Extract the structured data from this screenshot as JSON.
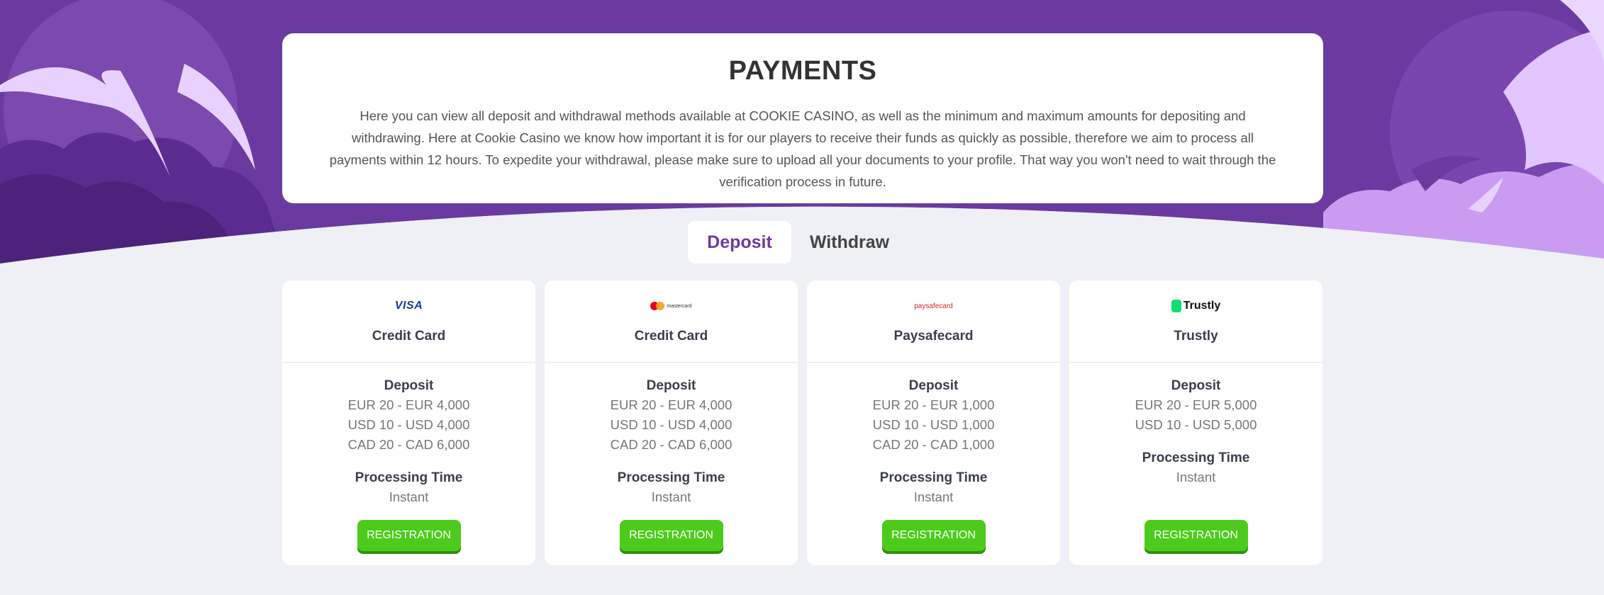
{
  "header": {
    "title": "PAYMENTS",
    "description": "Here you can view all deposit and withdrawal methods available at COOKIE CASINO, as well as the minimum and maximum amounts for depositing and withdrawing. Here at Cookie Casino we know how important it is for our players to receive their funds as quickly as possible, therefore we aim to process all payments within 12 hours. To expedite your withdrawal, please make sure to upload all your documents to your profile. That way you won't need to wait through the verification process in future."
  },
  "tabs": [
    {
      "label": "Deposit",
      "active": true
    },
    {
      "label": "Withdraw",
      "active": false
    }
  ],
  "colors": {
    "accent_purple": "#6f3a9e",
    "button_green": "#4ccb1c"
  },
  "methods": [
    {
      "logo": "visa-logo",
      "logo_text": "VISA",
      "name": "Credit Card",
      "deposit_title": "Deposit",
      "limits": [
        "EUR 20 - EUR 4,000",
        "USD 10 - USD 4,000",
        "CAD 20 - CAD 6,000"
      ],
      "processing_title": "Processing Time",
      "processing_value": "Instant",
      "button": "REGISTRATION"
    },
    {
      "logo": "mastercard-logo",
      "logo_text": "mastercard",
      "name": "Credit Card",
      "deposit_title": "Deposit",
      "limits": [
        "EUR 20 - EUR 4,000",
        "USD 10 - USD 4,000",
        "CAD 20 - CAD 6,000"
      ],
      "processing_title": "Processing Time",
      "processing_value": "Instant",
      "button": "REGISTRATION"
    },
    {
      "logo": "paysafecard-logo",
      "logo_text": "paysafecard",
      "name": "Paysafecard",
      "deposit_title": "Deposit",
      "limits": [
        "EUR 20 - EUR 1,000",
        "USD 10 - USD 1,000",
        "CAD 20 - CAD 1,000"
      ],
      "processing_title": "Processing Time",
      "processing_value": "Instant",
      "button": "REGISTRATION"
    },
    {
      "logo": "trustly-logo",
      "logo_text": "Trustly",
      "name": "Trustly",
      "deposit_title": "Deposit",
      "limits": [
        "EUR 20 - EUR 5,000",
        "USD 10 - USD 5,000"
      ],
      "processing_title": "Processing Time",
      "processing_value": "Instant",
      "button": "REGISTRATION"
    }
  ]
}
